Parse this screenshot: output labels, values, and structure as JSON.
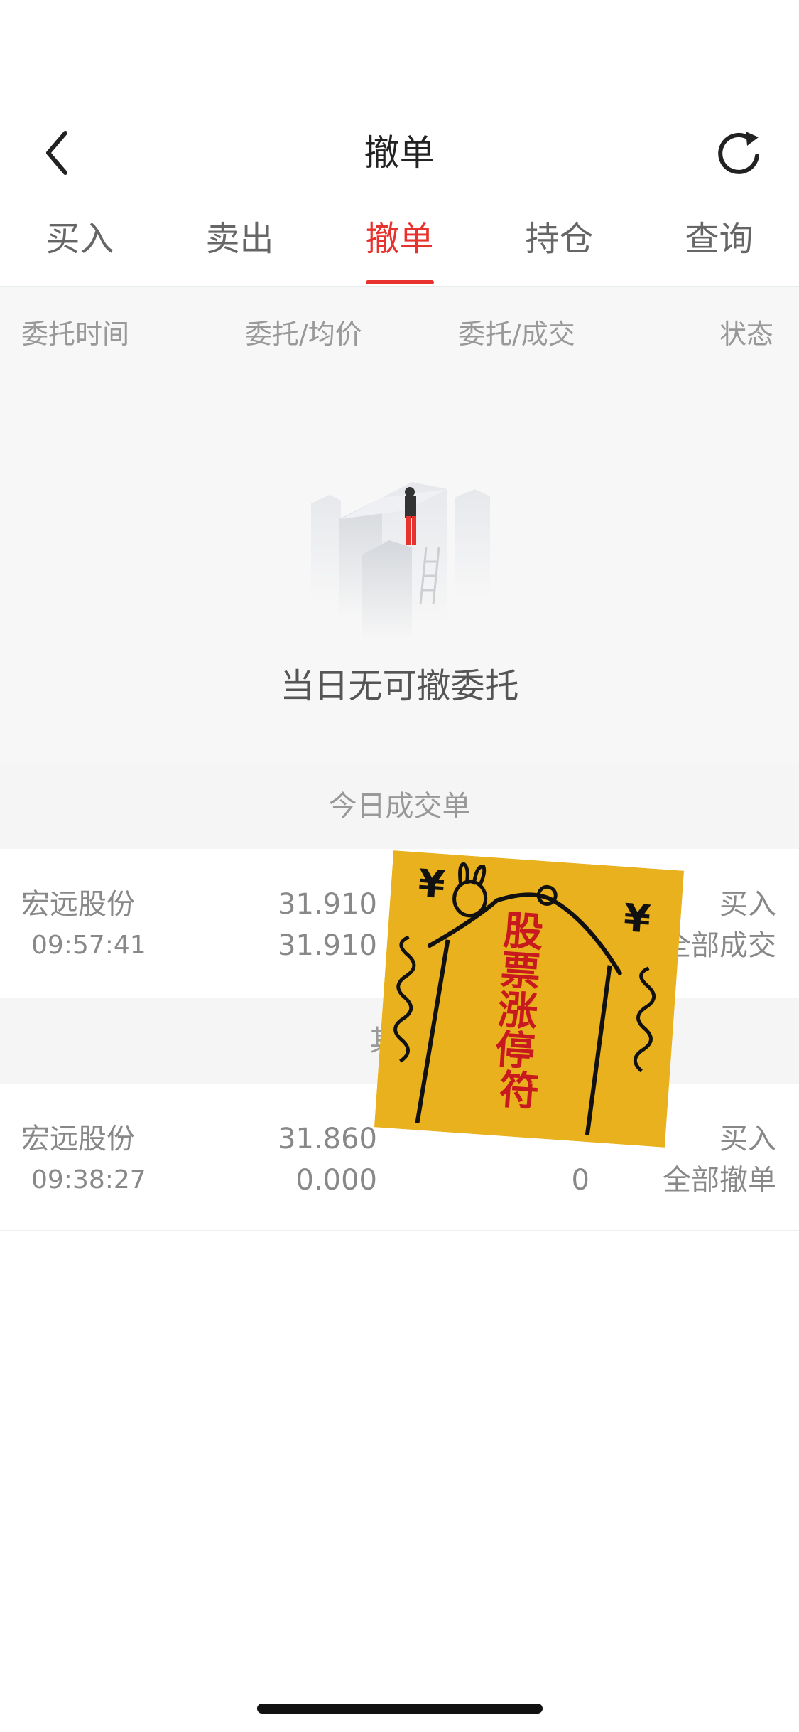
{
  "header": {
    "title": "撤单",
    "back_icon": "chevron-left-icon",
    "refresh_icon": "refresh-icon"
  },
  "tabs": [
    {
      "label": "买入",
      "active": false
    },
    {
      "label": "卖出",
      "active": false
    },
    {
      "label": "撤单",
      "active": true
    },
    {
      "label": "持仓",
      "active": false
    },
    {
      "label": "查询",
      "active": false
    }
  ],
  "columns": {
    "time": "委托时间",
    "price": "委托/均价",
    "qty": "委托/成交",
    "status": "状态"
  },
  "empty_state": {
    "text": "当日无可撤委托",
    "icon": "empty-buildings-illustration"
  },
  "today_deals": {
    "title": "今日成交单",
    "rows": [
      {
        "name": "宏远股份",
        "time": "09:57:41",
        "price": "31.910",
        "avg_price": "31.910",
        "direction": "买入",
        "status": "全部成交"
      }
    ]
  },
  "other_section": {
    "title": "其",
    "rows": [
      {
        "name": "宏远股份",
        "time": "09:38:27",
        "price": "31.860",
        "avg_price": "0.000",
        "deal_qty": "0",
        "direction": "买入",
        "status": "全部撤单"
      }
    ]
  },
  "sticker": {
    "text": "股票涨停符",
    "symbol": "¥",
    "colors": {
      "background": "#e9b11e",
      "text": "#c8191e",
      "line": "#111111"
    }
  },
  "colors": {
    "accent": "#e8322d",
    "muted_text": "#999999",
    "section_bg": "#f5f5f5"
  }
}
